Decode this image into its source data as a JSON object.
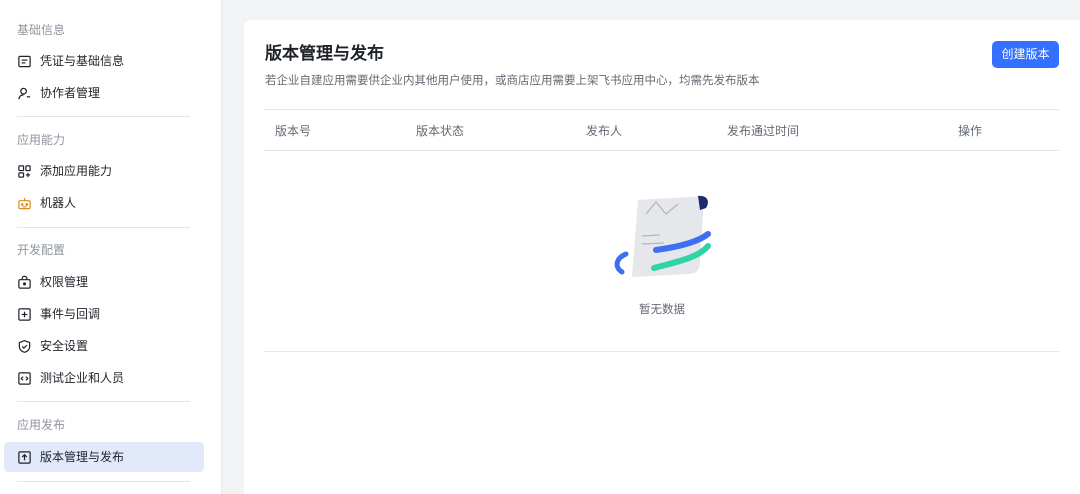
{
  "sidebar": {
    "sections": [
      {
        "title": "基础信息",
        "items": [
          {
            "label": "凭证与基础信息",
            "icon": "credentials-icon"
          },
          {
            "label": "协作者管理",
            "icon": "user-icon"
          }
        ]
      },
      {
        "title": "应用能力",
        "items": [
          {
            "label": "添加应用能力",
            "icon": "grid-add-icon"
          },
          {
            "label": "机器人",
            "icon": "robot-icon"
          }
        ]
      },
      {
        "title": "开发配置",
        "items": [
          {
            "label": "权限管理",
            "icon": "lock-box-icon"
          },
          {
            "label": "事件与回调",
            "icon": "event-icon"
          },
          {
            "label": "安全设置",
            "icon": "shield-icon"
          },
          {
            "label": "测试企业和人员",
            "icon": "code-icon"
          }
        ]
      },
      {
        "title": "应用发布",
        "items": [
          {
            "label": "版本管理与发布",
            "icon": "upload-icon",
            "active": true
          }
        ]
      }
    ]
  },
  "main": {
    "title": "版本管理与发布",
    "description": "若企业自建应用需要供企业内其他用户使用，或商店应用需要上架飞书应用中心，均需先发布版本",
    "create_button": "创建版本",
    "table": {
      "columns": [
        "版本号",
        "版本状态",
        "发布人",
        "发布通过时间",
        "操作"
      ],
      "rows": []
    },
    "empty_text": "暂无数据"
  },
  "colors": {
    "accent": "#3370ff",
    "active_bg": "#e1e9fb",
    "robot_icon": "#e08a1e",
    "illus_blue": "#3d6ff0",
    "illus_teal": "#2ed3a6"
  }
}
